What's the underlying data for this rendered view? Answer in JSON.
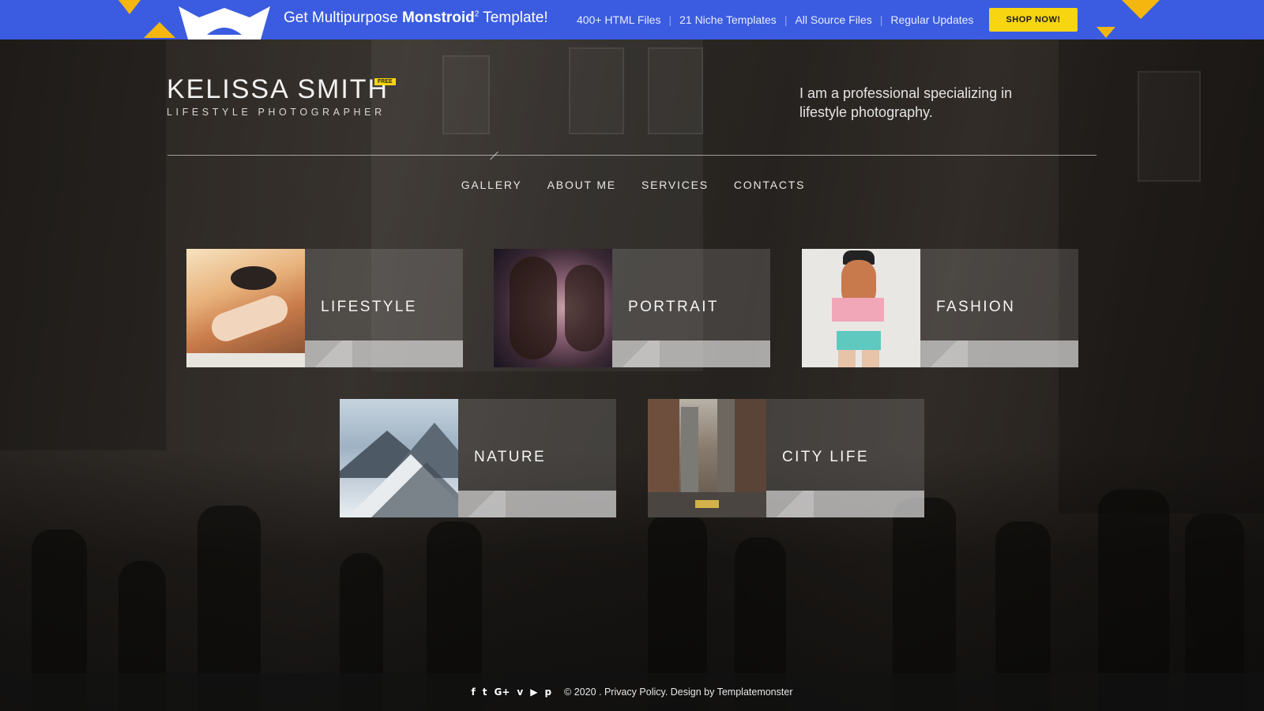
{
  "promo": {
    "title_pre": "Get Multipurpose ",
    "title_brand": "Monstroid",
    "title_sup": "2",
    "title_post": " Template!",
    "features": [
      "400+ HTML Files",
      "21 Niche Templates",
      "All Source Files",
      "Regular Updates"
    ],
    "button_label": "SHOP NOW!",
    "colors": {
      "background": "#3b5ce0",
      "button": "#f7d511"
    }
  },
  "header": {
    "name": "KELISSA SMITH",
    "badge": "FREE",
    "subtitle": "LIFESTYLE PHOTOGRAPHER",
    "tagline": "I am a professional specializing in lifestyle photography."
  },
  "nav": {
    "items": [
      {
        "label": "GALLERY"
      },
      {
        "label": "ABOUT ME"
      },
      {
        "label": "SERVICES"
      },
      {
        "label": "CONTACTS"
      }
    ]
  },
  "gallery": {
    "tiles": [
      {
        "label": "LIFESTYLE",
        "image": "woman-in-hat-sunbathing-photo"
      },
      {
        "label": "PORTRAIT",
        "image": "curly-hair-woman-portrait-photo"
      },
      {
        "label": "FASHION",
        "image": "woman-in-cap-fashion-photo"
      },
      {
        "label": "NATURE",
        "image": "snowy-mountains-photo"
      },
      {
        "label": "CITY LIFE",
        "image": "city-street-skyscrapers-photo"
      }
    ]
  },
  "footer": {
    "social_icons": [
      "facebook-icon",
      "twitter-icon",
      "google-plus-icon",
      "vimeo-icon",
      "youtube-icon",
      "pinterest-icon"
    ],
    "social_glyphs": [
      "f",
      "t",
      "G+",
      "v",
      "▶",
      "p"
    ],
    "copyright": "© 2020 . Privacy Policy. Design by Templatemonster"
  }
}
